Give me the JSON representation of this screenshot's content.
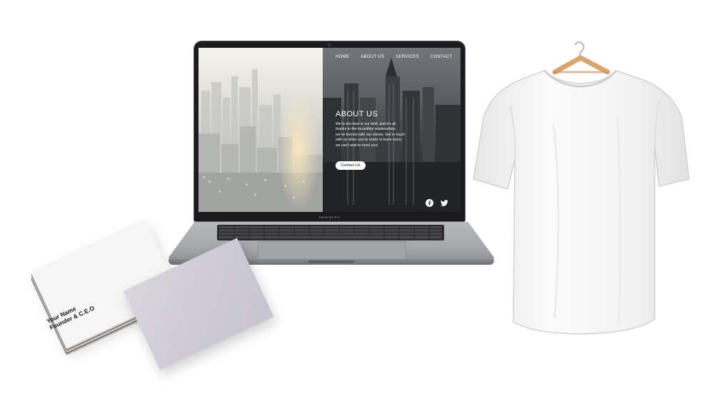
{
  "website": {
    "nav": [
      "HOME",
      "ABOUT US",
      "SERVICES",
      "CONTACT"
    ],
    "section_title": "ABOUT US",
    "body_lines": [
      "We're the best in our field, and it's all",
      "thanks to the incredible relationships",
      "we've formed with our clients. Get in touch",
      "with us when you're ready to learn more;",
      "we can't wait to meet you!"
    ],
    "cta_label": "Contact Us",
    "social_icons": [
      "facebook-icon",
      "twitter-icon"
    ]
  },
  "laptop": {
    "model_label": "MacBook Pro"
  },
  "business_card": {
    "line1": "Your Name",
    "line2": "Founder & C.E.O"
  },
  "colors": {
    "background": "#ffffff",
    "screen_bezel": "#1b1b1d",
    "laptop_body": "#a6a8ac",
    "card_front": "#cecbd6",
    "tshirt": "#f4f4f4",
    "hanger": "#d9a56c"
  }
}
